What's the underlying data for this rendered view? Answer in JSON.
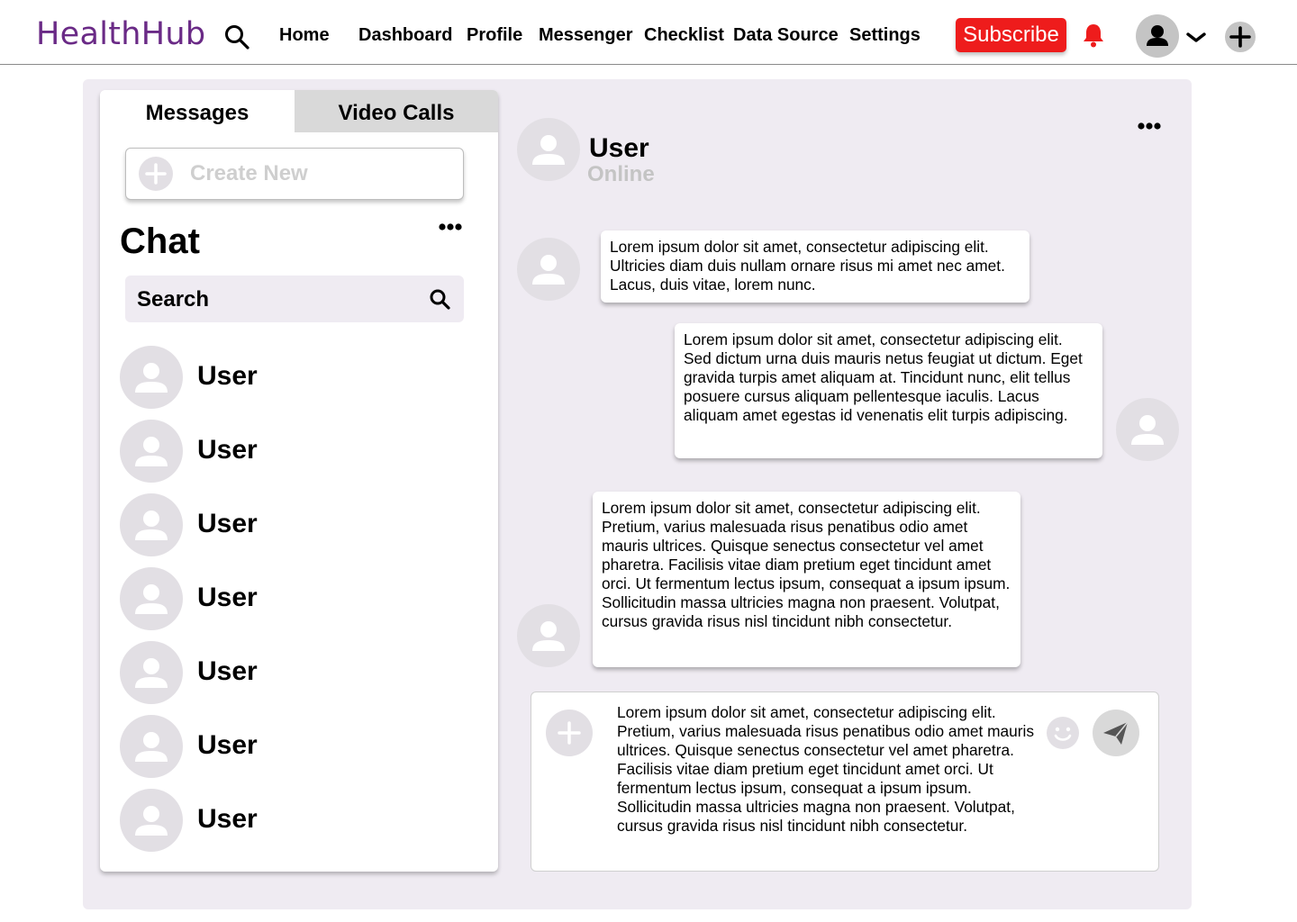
{
  "app": {
    "brand": "HealthHub"
  },
  "nav": {
    "links": [
      "Home",
      "Dashboard",
      "Profile",
      "Messenger",
      "Checklist",
      "Data Source",
      "Settings"
    ],
    "subscribe_label": "Subscribe"
  },
  "tabs": {
    "messages": "Messages",
    "video_calls": "Video Calls"
  },
  "create_new": {
    "label": "Create New"
  },
  "chat_list": {
    "title": "Chat",
    "search_label": "Search",
    "users": [
      "User",
      "User",
      "User",
      "User",
      "User",
      "User",
      "User"
    ]
  },
  "conversation": {
    "header": {
      "name": "User",
      "status": "Online"
    },
    "messages": [
      {
        "side": "left",
        "text": "Lorem ipsum dolor sit amet, consectetur adipiscing elit. Ultricies diam duis nullam ornare risus mi amet nec amet. Lacus, duis vitae, lorem nunc."
      },
      {
        "side": "right",
        "text": "Lorem ipsum dolor sit amet, consectetur adipiscing elit. Sed dictum urna duis mauris netus feugiat ut dictum. Eget gravida turpis amet aliquam at. Tincidunt nunc, elit tellus posuere cursus aliquam pellentesque iaculis. Lacus aliquam amet egestas id venenatis elit turpis adipiscing."
      },
      {
        "side": "left",
        "text": "Lorem ipsum dolor sit amet, consectetur adipiscing elit. Pretium, varius malesuada risus penatibus odio amet mauris ultrices. Quisque senectus consectetur vel amet pharetra. Facilisis vitae diam pretium eget tincidunt amet orci. Ut fermentum lectus ipsum, consequat a ipsum ipsum. Sollicitudin massa ultricies magna non praesent. Volutpat, cursus gravida risus nisl tincidunt nibh consectetur."
      }
    ]
  },
  "composer": {
    "value": "Lorem ipsum dolor sit amet, consectetur adipiscing elit. Pretium, varius malesuada risus penatibus odio amet mauris ultrices. Quisque senectus consectetur vel amet pharetra. Facilisis vitae diam pretium eget tincidunt amet orci. Ut fermentum lectus ipsum, consequat a ipsum ipsum. Sollicitudin massa ultricies magna non praesent. Volutpat, cursus gravida risus nisl tincidunt nibh consectetur."
  },
  "icons": {
    "search": "search-icon",
    "bell": "bell-icon",
    "avatar": "user-avatar-icon",
    "chevron": "chevron-down-icon",
    "plus": "plus-icon",
    "more": "more-dots-icon",
    "emoji": "emoji-icon",
    "send": "send-icon"
  },
  "colors": {
    "brand": "#6a2a86",
    "subscribe": "#ee1c1c",
    "bell": "#ee1c1c",
    "panel_bg": "#efebf2",
    "avatar_bg": "#e2dfe4",
    "muted": "#c4c4c4"
  }
}
